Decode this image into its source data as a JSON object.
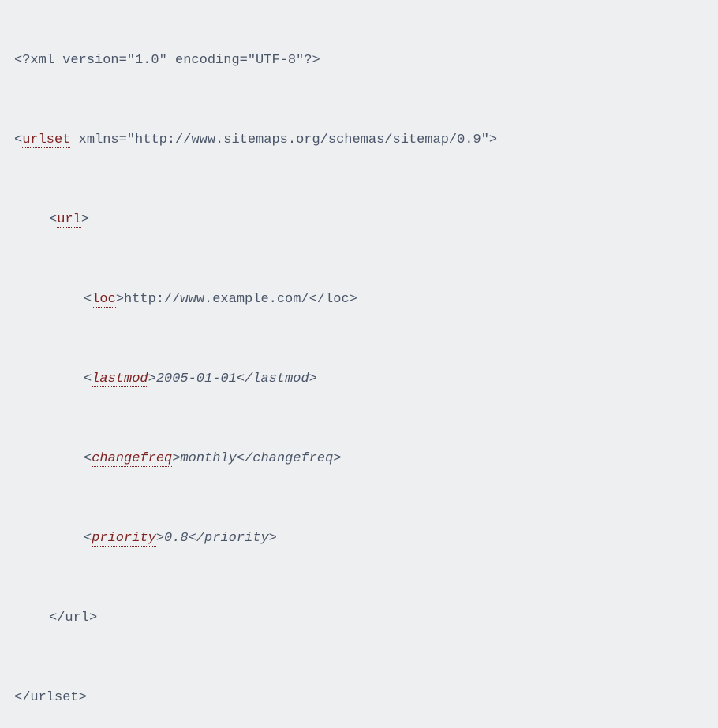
{
  "xml_decl": "<?xml version=\"1.0\" encoding=\"UTF-8\"?>",
  "urlset": {
    "open_prefix": "<",
    "tag_name": "urlset",
    "attr_text": " xmlns=\"http://www.sitemaps.org/schemas/sitemap/0.9\">",
    "close": "</urlset>"
  },
  "url": {
    "open_prefix": "<",
    "tag_name": "url",
    "open_suffix": ">",
    "close": "</url>"
  },
  "loc": {
    "open_prefix": "<",
    "tag_name": "loc",
    "open_suffix": ">",
    "value": "http://www.example.com/",
    "close": "</loc>"
  },
  "lastmod": {
    "open_prefix": "<",
    "tag_name": "lastmod",
    "open_suffix": ">",
    "value": "2005-01-01",
    "close": "</lastmod>"
  },
  "changefreq": {
    "open_prefix": "<",
    "tag_name": "changefreq",
    "open_suffix": ">",
    "value": "monthly",
    "close": "</changefreq>"
  },
  "priority": {
    "open_prefix": "<",
    "tag_name": "priority",
    "open_suffix": ">",
    "value": "0.8",
    "close": "</priority>"
  }
}
